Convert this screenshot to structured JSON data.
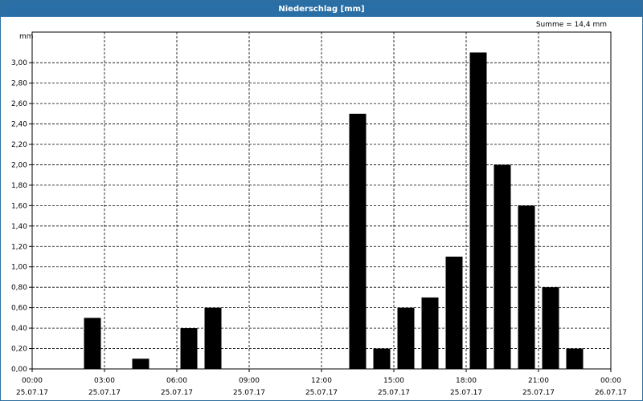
{
  "window": {
    "title": "Niederschlag [mm]"
  },
  "chart_data": {
    "type": "bar",
    "title": "Niederschlag [mm]",
    "ylabel": "mm",
    "annotation": "Summe = 14,4 mm",
    "ylim": [
      0,
      3.3
    ],
    "y_ticks": [
      "0,00",
      "0,20",
      "0,40",
      "0,60",
      "0,80",
      "1,00",
      "1,20",
      "1,40",
      "1,60",
      "1,80",
      "2,00",
      "2,20",
      "2,40",
      "2,60",
      "2,80",
      "3,00"
    ],
    "x_range_hours": [
      0,
      24
    ],
    "x_ticks": [
      {
        "time": "00:00",
        "date": "25.07.17"
      },
      {
        "time": "03:00",
        "date": "25.07.17"
      },
      {
        "time": "06:00",
        "date": "25.07.17"
      },
      {
        "time": "09:00",
        "date": "25.07.17"
      },
      {
        "time": "12:00",
        "date": "25.07.17"
      },
      {
        "time": "15:00",
        "date": "25.07.17"
      },
      {
        "time": "18:00",
        "date": "25.07.17"
      },
      {
        "time": "21:00",
        "date": "25.07.17"
      },
      {
        "time": "00:00",
        "date": "26.07.17"
      }
    ],
    "grid": true,
    "bar_color": "#000000",
    "bars": [
      {
        "hour": 2,
        "value": 0.5
      },
      {
        "hour": 4,
        "value": 0.1
      },
      {
        "hour": 6,
        "value": 0.4
      },
      {
        "hour": 7,
        "value": 0.6
      },
      {
        "hour": 13,
        "value": 2.5
      },
      {
        "hour": 14,
        "value": 0.2
      },
      {
        "hour": 15,
        "value": 0.6
      },
      {
        "hour": 16,
        "value": 0.7
      },
      {
        "hour": 17,
        "value": 1.1
      },
      {
        "hour": 18,
        "value": 3.1
      },
      {
        "hour": 19,
        "value": 2.0
      },
      {
        "hour": 20,
        "value": 1.6
      },
      {
        "hour": 21,
        "value": 0.8
      },
      {
        "hour": 22,
        "value": 0.2
      }
    ]
  }
}
